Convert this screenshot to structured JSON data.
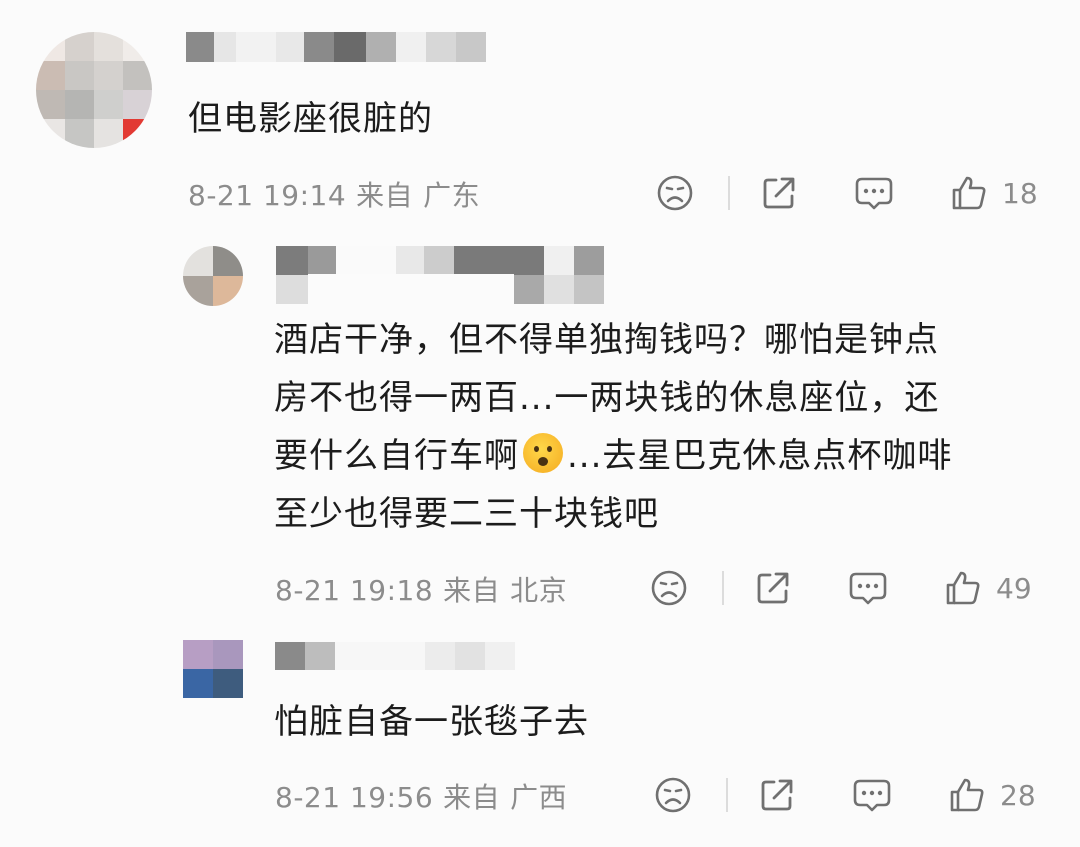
{
  "comments": [
    {
      "text": "但电影座很脏的",
      "date": "8-21 19:14",
      "from": "来自",
      "location": "广东",
      "likes": "18"
    },
    {
      "text_before_emoji": "酒店干净，但不得单独掏钱吗？哪怕是钟点\n房不也得一两百...一两块钱的休息座位，还\n要什么自行车啊",
      "emoji": "frowning-open-mouth-emoji",
      "text_after_emoji": "...去星巴克休息点杯咖啡\n至少也得要二三十块钱吧",
      "date": "8-21 19:18",
      "from": "来自",
      "location": "北京",
      "likes": "49"
    },
    {
      "text": "怕脏自备一张毯子去",
      "date": "8-21 19:56",
      "from": "来自",
      "location": "广西",
      "likes": "28"
    }
  ],
  "icons": [
    "dislike-icon",
    "share-icon",
    "reply-icon",
    "like-icon"
  ],
  "colors": {
    "text": "#1c1c1c",
    "meta": "#8c8c8c",
    "icon": "#707070",
    "background": "#fbfbfb"
  }
}
